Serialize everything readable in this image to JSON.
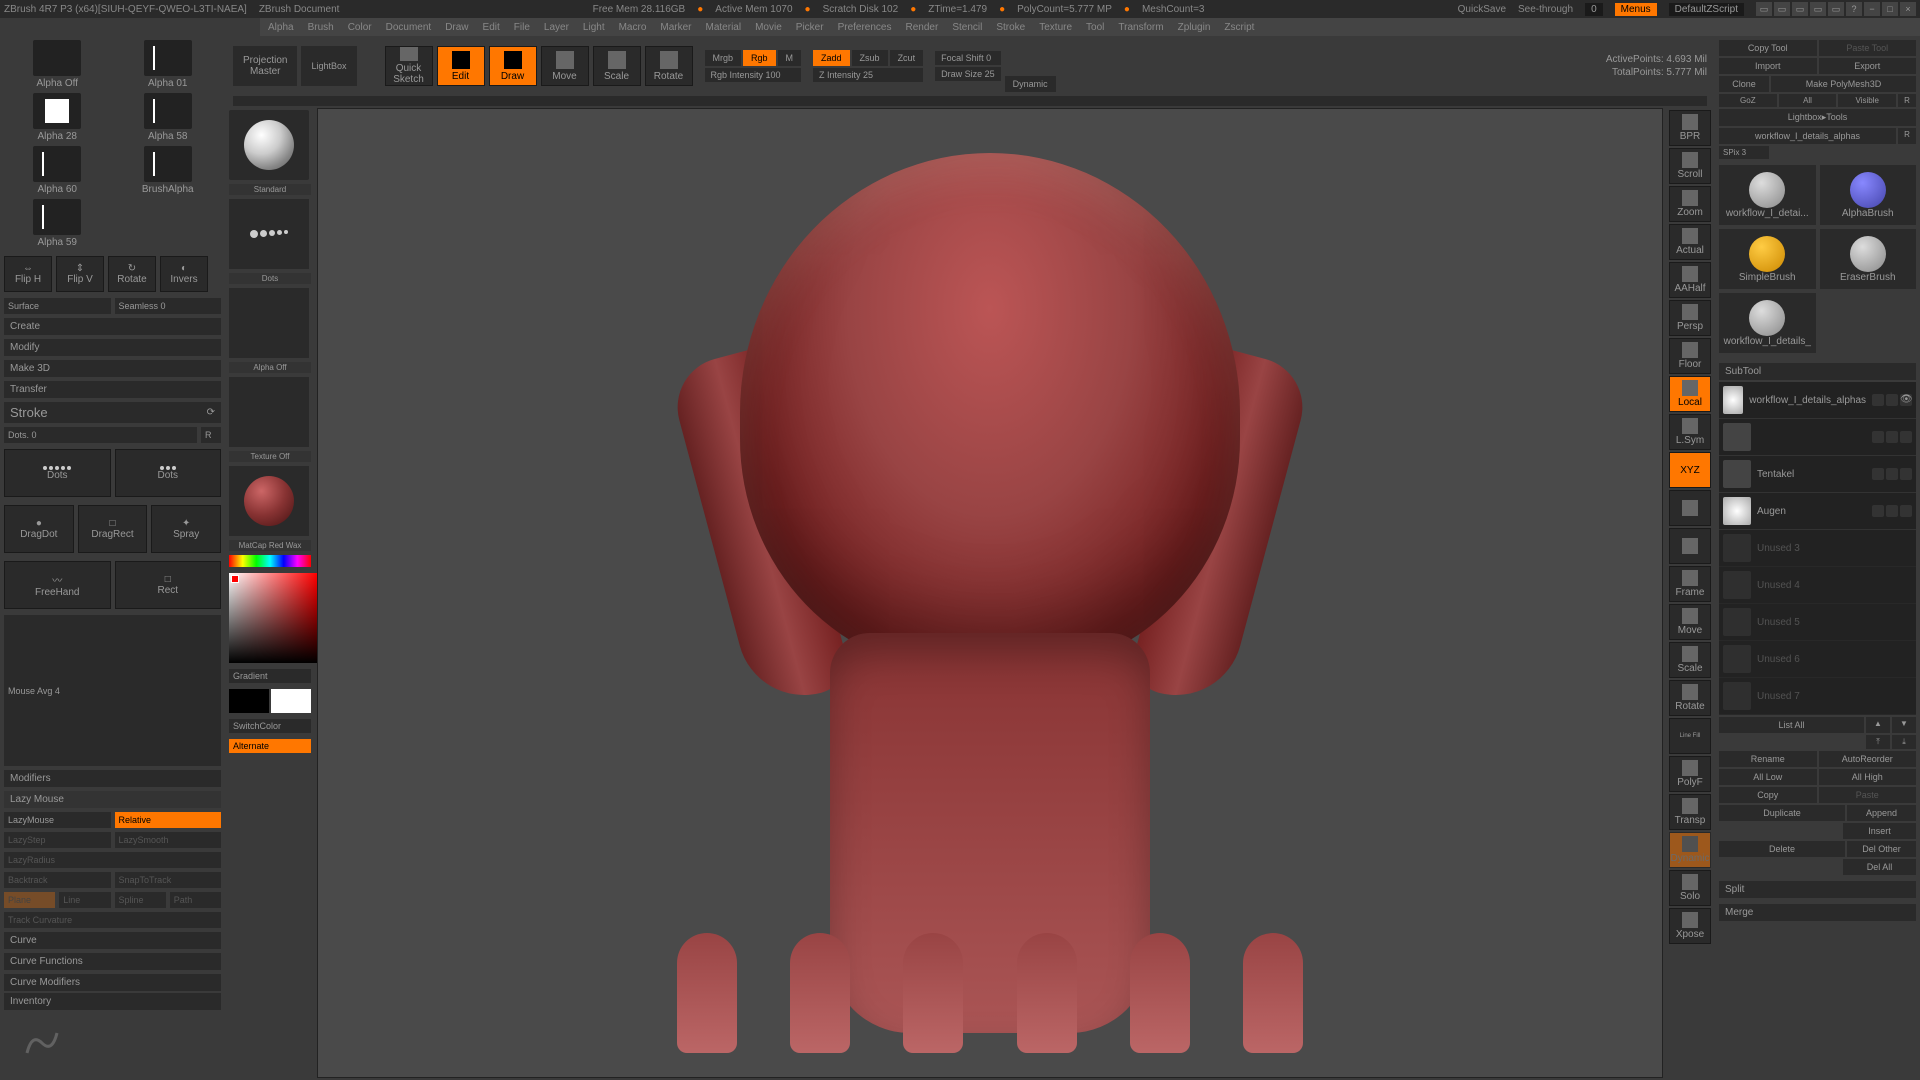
{
  "title": "ZBrush 4R7 P3 (x64)[SIUH-QEYF-QWEO-L3TI-NAEA]",
  "doc": "ZBrush Document",
  "status": {
    "mem": "Free Mem 28.116GB",
    "active": "Active Mem 1070",
    "scratch": "Scratch Disk 102",
    "ztime": "ZTime=1.479",
    "poly": "PolyCount=5.777 MP",
    "mesh": "MeshCount=3"
  },
  "topbtns": {
    "quicksave": "QuickSave",
    "see": "See-through",
    "seeval": "0",
    "menus": "Menus",
    "script": "DefaultZScript"
  },
  "menu": [
    "Alpha",
    "Brush",
    "Color",
    "Document",
    "Draw",
    "Edit",
    "File",
    "Layer",
    "Light",
    "Macro",
    "Marker",
    "Material",
    "Movie",
    "Picker",
    "Preferences",
    "Render",
    "Stencil",
    "Stroke",
    "Texture",
    "Tool",
    "Transform",
    "Zplugin",
    "Zscript"
  ],
  "alphas": [
    {
      "l": "Alpha Off"
    },
    {
      "l": "Alpha 01"
    },
    {
      "l": "Alpha 28"
    },
    {
      "l": "Alpha 58"
    },
    {
      "l": "Alpha 60"
    },
    {
      "l": "BrushAlpha"
    },
    {
      "l": "Alpha 59"
    }
  ],
  "flipbtns": [
    "Flip H",
    "Flip V",
    "Rotate",
    "Invers"
  ],
  "surface": "Surface",
  "seamless": "Seamless 0",
  "sections": {
    "create": "Create",
    "modify": "Modify",
    "make3d": "Make 3D",
    "transfer": "Transfer"
  },
  "stroke": {
    "title": "Stroke",
    "dots": "Dots. 0",
    "r": "R"
  },
  "strokes": [
    {
      "l": "Dots"
    },
    {
      "l": "Dots"
    },
    {
      "l": "DragDot"
    },
    {
      "l": "DragRect"
    },
    {
      "l": "Spray"
    },
    {
      "l": "FreeHand"
    },
    {
      "l": "Rect"
    }
  ],
  "mouseavg": "Mouse Avg 4",
  "modifiers": "Modifiers",
  "lazymouse": "Lazy Mouse",
  "lazy": {
    "l1": "LazyMouse",
    "l2": "Relative",
    "l3": "LazyStep",
    "l4": "LazySmooth",
    "l5": "LazyRadius",
    "l6": "Backtrack",
    "l7": "SnapToTrack",
    "l8": "Plane",
    "l9": "Line",
    "l10": "Spline",
    "l11": "Path",
    "l12": "Track Curvature"
  },
  "curve": {
    "c1": "Curve",
    "c2": "Curve Functions",
    "c3": "Curve Modifiers"
  },
  "inventory": "Inventory",
  "toolbar": {
    "proj1": "Projection",
    "proj2": "Master",
    "lightbox": "LightBox",
    "quick1": "Quick",
    "quick2": "Sketch",
    "edit": "Edit",
    "draw": "Draw",
    "move": "Move",
    "scale": "Scale",
    "rotate": "Rotate"
  },
  "rgb": {
    "mrgb": "Mrgb",
    "rgb": "Rgb",
    "m": "M",
    "intensity": "Rgb Intensity 100",
    "zadd": "Zadd",
    "zsub": "Zsub",
    "zcut": "Zcut",
    "zint": "Z Intensity 25",
    "focal": "Focal Shift 0",
    "draw": "Draw Size 25",
    "dynamic": "Dynamic"
  },
  "stats": {
    "active": "ActivePoints: 4.693 Mil",
    "total": "TotalPoints: 5.777 Mil"
  },
  "previews": {
    "standard": "Standard",
    "dots": "Dots",
    "alpha": "Alpha Off",
    "texture": "Texture Off",
    "matcap": "MatCap Red Wax",
    "gradient": "Gradient",
    "switch": "SwitchColor",
    "alternate": "Alternate"
  },
  "rtools": [
    "BPR",
    "Scroll",
    "Zoom",
    "Actual",
    "AAHalf",
    "Persp",
    "Floor",
    "Local",
    "L.Sym",
    "XYZ",
    "",
    "",
    "Frame",
    "",
    "Move",
    "",
    "Scale",
    "",
    "Rotate",
    "Line Fill",
    "PolyF",
    "",
    "Transp",
    "",
    "Dynamic",
    "",
    "Solo",
    "",
    "Xpose"
  ],
  "rp": {
    "copytool": "Copy Tool",
    "pastetool": "Paste Tool",
    "import": "Import",
    "export": "Export",
    "clone": "Clone",
    "makepoly": "Make PolyMesh3D",
    "goz": "GoZ",
    "all": "All",
    "visible": "Visible",
    "r": "R",
    "lbtools": "Lightbox▸Tools",
    "toolname": "workflow_I_details_alphas",
    "spix": "SPix 3",
    "tools": [
      {
        "l": "workflow_I_detai..."
      },
      {
        "l": "AlphaBrush"
      },
      {
        "l": "SimpleBrush"
      },
      {
        "l": "EraserBrush"
      },
      {
        "l": "workflow_I_details_"
      }
    ],
    "subtool": "SubTool",
    "subtools": [
      {
        "n": "workflow_I_details_alphas"
      },
      {
        "n": ""
      },
      {
        "n": "Tentakel"
      },
      {
        "n": "Augen"
      },
      {
        "n": "Unused 3"
      },
      {
        "n": "Unused 4"
      },
      {
        "n": "Unused 5"
      },
      {
        "n": "Unused 6"
      },
      {
        "n": "Unused 7"
      }
    ],
    "listall": "List All",
    "rename": "Rename",
    "autoreorder": "AutoReorder",
    "alllow": "All Low",
    "allhigh": "All High",
    "copy": "Copy",
    "paste": "Paste",
    "duplicate": "Duplicate",
    "append": "Append",
    "insert": "Insert",
    "delete": "Delete",
    "delother": "Del Other",
    "delall": "Del All",
    "split": "Split",
    "merge": "Merge"
  }
}
